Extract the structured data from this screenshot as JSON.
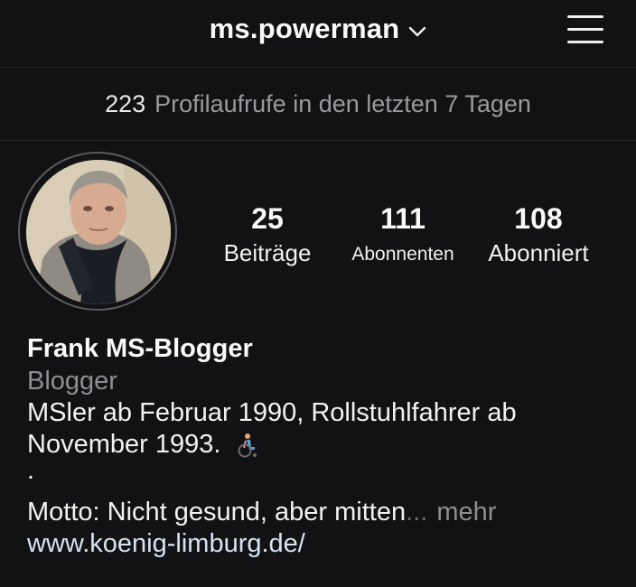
{
  "header": {
    "username": "ms.powerman",
    "icons": {
      "switch_account": "chevron-down-icon",
      "menu": "hamburger-menu-icon"
    }
  },
  "insights": {
    "count": "223",
    "label": "Profilaufrufe in den letzten 7 Tagen"
  },
  "profile": {
    "stats": [
      {
        "value": "25",
        "label": "Beiträge"
      },
      {
        "value": "111",
        "label": "Abonnenten"
      },
      {
        "value": "108",
        "label": "Abonniert"
      }
    ],
    "name": "Frank MS-Blogger",
    "category": "Blogger",
    "bio_line1": "MSler ab Februar 1990, Rollstuhlfahrer ab",
    "bio_line2": "November 1993.",
    "bio_emoji": "wheelchair-person-icon",
    "bio_dot": ".",
    "motto": "Motto: Nicht gesund, aber mitten",
    "ellipsis": "...",
    "more": "mehr",
    "website": "www.koenig-limburg.de/"
  },
  "colors": {
    "background": "#121214",
    "text": "#f5f5f5",
    "muted": "#8e8e93",
    "link": "#d8e3f2",
    "divider": "#26262a"
  }
}
